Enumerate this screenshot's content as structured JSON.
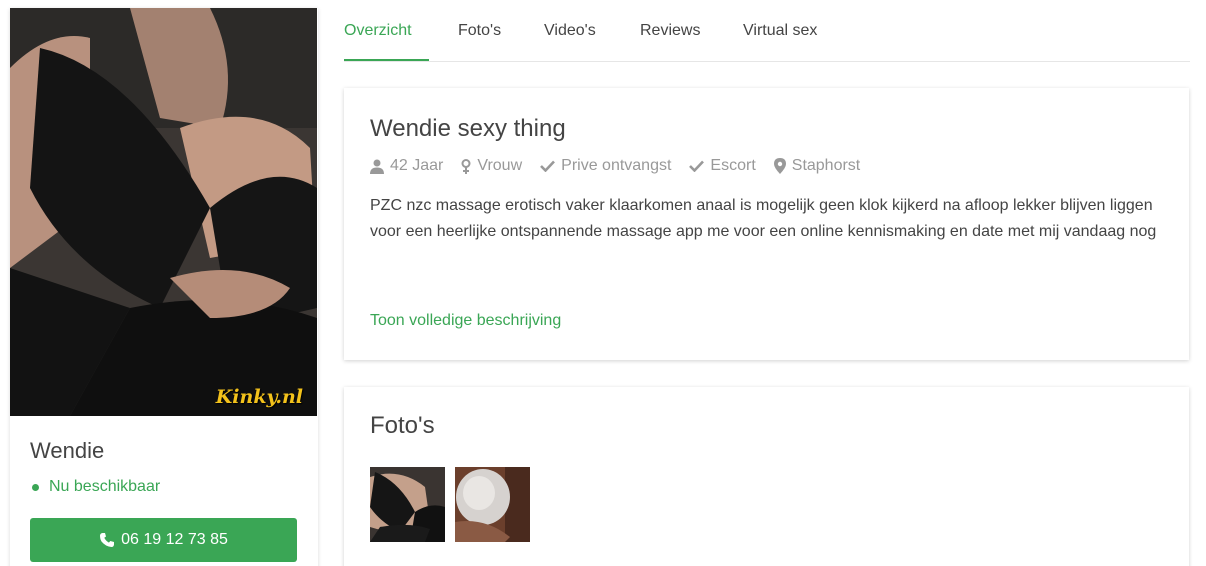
{
  "profile": {
    "name": "Wendie",
    "availability": "Nu beschikbaar",
    "phone": "06 19 12 73 85",
    "photo_watermark": "Kinky.nl"
  },
  "tabs": [
    {
      "label": "Overzicht",
      "active": true
    },
    {
      "label": "Foto's",
      "active": false
    },
    {
      "label": "Video's",
      "active": false
    },
    {
      "label": "Reviews",
      "active": false
    },
    {
      "label": "Virtual sex",
      "active": false
    }
  ],
  "overview": {
    "title": "Wendie sexy thing",
    "meta": {
      "age": "42 Jaar",
      "gender": "Vrouw",
      "receives": "Prive ontvangst",
      "service": "Escort",
      "location": "Staphorst"
    },
    "description": "PZC nzc massage erotisch vaker klaarkomen anaal is mogelijk geen klok kijkerd na afloop lekker blijven liggen voor een heerlijke ontspannende massage app me voor een online kennismaking en date met mij vandaag nog",
    "show_more": "Toon volledige beschrijving"
  },
  "photos": {
    "title": "Foto's"
  },
  "colors": {
    "accent": "#3aa655",
    "muted": "#999999",
    "watermark": "#f3c21b"
  },
  "icons": [
    "user-icon",
    "gender-icon",
    "check-icon",
    "map-marker-icon",
    "phone-icon",
    "status-dot-icon"
  ]
}
